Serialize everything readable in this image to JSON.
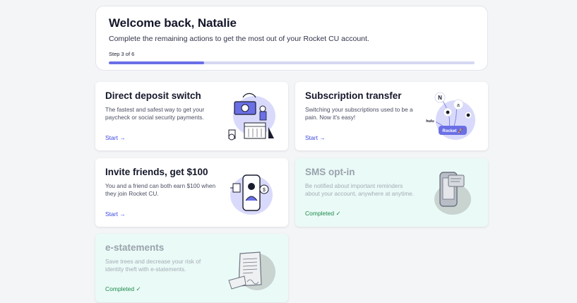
{
  "welcome": {
    "title": "Welcome back, Natalie",
    "subtitle": "Complete the remaining actions to get the most out of your Rocket CU account.",
    "step_label": "Step 3 of 6",
    "progress_fraction": 0.26
  },
  "cards": [
    {
      "title": "Direct deposit switch",
      "description": "The fastest and safest way to get your paycheck or social security payments.",
      "action": "Start →",
      "status": "pending",
      "illustration": "direct-deposit-illustration"
    },
    {
      "title": "Subscription transfer",
      "description": "Switching your subscriptions used to be a pain. Now it's easy!",
      "action": "Start →",
      "status": "pending",
      "illustration": "subscription-illustration",
      "illustration_labels": {
        "hulu": "hulu",
        "rocket": "Rocket 🚀",
        "n": "N",
        "a": "a"
      }
    },
    {
      "title": "Invite friends, get $100",
      "description": "You and a friend can both earn $100 when they join Rocket CU.",
      "action": "Start →",
      "status": "pending",
      "illustration": "invite-friends-illustration"
    },
    {
      "title": "SMS opt-in",
      "description": "Be notified about important reminders about your account, anywhere at anytime.",
      "action": "Completed ✓",
      "status": "completed",
      "illustration": "sms-phone-illustration"
    },
    {
      "title": "e-statements",
      "description": "Save trees and decrease your risk of identity theft with e-statements.",
      "action": "Completed ✓",
      "status": "completed",
      "illustration": "document-illustration"
    }
  ],
  "colors": {
    "accent": "#3b48e0",
    "progress_fill": "#6a6fe6",
    "progress_track": "#d6d8f3",
    "completed_bg": "#eafaf6",
    "completed_text": "#1e8a4e"
  }
}
